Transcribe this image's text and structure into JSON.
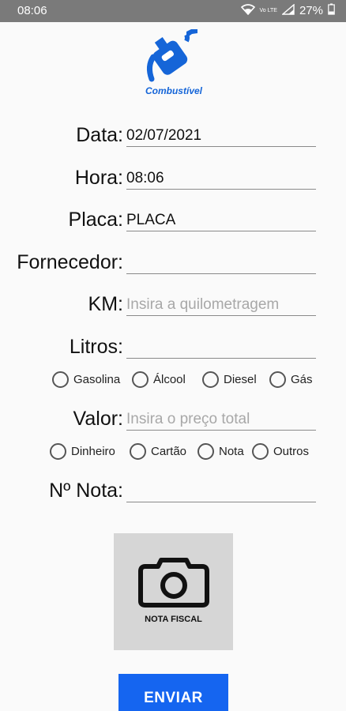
{
  "status": {
    "time": "08:06",
    "network": "Vo LTE",
    "battery": "27%"
  },
  "brand": {
    "name": "Combustível",
    "color": "#1565d8"
  },
  "form": {
    "data": {
      "label": "Data:",
      "value": "02/07/2021",
      "placeholder": ""
    },
    "hora": {
      "label": "Hora:",
      "value": "08:06",
      "placeholder": ""
    },
    "placa": {
      "label": "Placa:",
      "value": "PLACA",
      "placeholder": ""
    },
    "fornecedor": {
      "label": "Fornecedor:",
      "value": "",
      "placeholder": ""
    },
    "km": {
      "label": "KM:",
      "value": "",
      "placeholder": "Insira a quilometragem"
    },
    "litros": {
      "label": "Litros:",
      "value": "",
      "placeholder": ""
    },
    "fuel_options": [
      "Gasolina",
      "Álcool",
      "Diesel",
      "Gás"
    ],
    "valor": {
      "label": "Valor:",
      "value": "",
      "placeholder": "Insira o preço total"
    },
    "payment_options": [
      "Dinheiro",
      "Cartão",
      "Nota",
      "Outros"
    ],
    "nota": {
      "label": "Nº Nota:",
      "value": "",
      "placeholder": ""
    }
  },
  "camera": {
    "caption": "NOTA FISCAL",
    "icon": "camera-icon"
  },
  "submit": {
    "label": "ENVIAR",
    "color": "#1565f0"
  }
}
